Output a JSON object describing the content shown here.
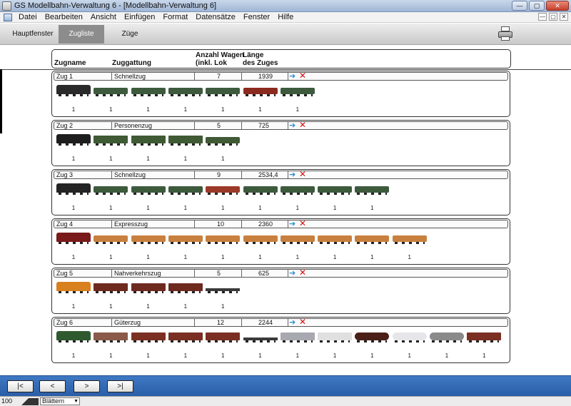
{
  "window": {
    "title": "GS Modellbahn-Verwaltung 6 - [Modellbahn-Verwaltung 6]",
    "controls": [
      "—",
      "▢",
      "✕"
    ]
  },
  "menu": [
    "Datei",
    "Bearbeiten",
    "Ansicht",
    "Einfügen",
    "Format",
    "Datensätze",
    "Fenster",
    "Hilfe"
  ],
  "tabs": [
    {
      "label": "Hauptfenster",
      "active": false
    },
    {
      "label": "Zugliste",
      "active": true
    },
    {
      "label": "Züge",
      "active": false
    }
  ],
  "columns": {
    "name": "Zugname",
    "type": "Zuggattung",
    "count_line1": "Anzahl Wagen",
    "count_line2": "(inkl. Lok",
    "length_line1": "Länge",
    "length_line2": "des Zuges"
  },
  "trains": [
    {
      "name": "Zug 1",
      "type": "Schnellzug",
      "count": "7",
      "length": "1939",
      "vehicles": [
        {
          "kind": "loco",
          "color": "#2a2a2a",
          "qty": "1"
        },
        {
          "kind": "car",
          "color": "#3d5a3d",
          "qty": "1"
        },
        {
          "kind": "car",
          "color": "#3d5a3d",
          "qty": "1"
        },
        {
          "kind": "car",
          "color": "#3d5a3d",
          "qty": "1"
        },
        {
          "kind": "car",
          "color": "#3d5a3d",
          "qty": "1"
        },
        {
          "kind": "car",
          "color": "#8b2a1e",
          "qty": "1"
        },
        {
          "kind": "car",
          "color": "#3d5a3d",
          "qty": "1"
        }
      ]
    },
    {
      "name": "Zug 2",
      "type": "Personenzug",
      "count": "5",
      "length": "725",
      "vehicles": [
        {
          "kind": "loco",
          "color": "#1e1e1e",
          "qty": "1"
        },
        {
          "kind": "wagon",
          "color": "#3f5a34",
          "qty": "1"
        },
        {
          "kind": "wagon",
          "color": "#3f5a34",
          "qty": "1"
        },
        {
          "kind": "wagon",
          "color": "#3f5a34",
          "qty": "1"
        },
        {
          "kind": "car",
          "color": "#3f5a34",
          "qty": "1"
        }
      ]
    },
    {
      "name": "Zug 3",
      "type": "Schnellzug",
      "count": "9",
      "length": "2534,4",
      "vehicles": [
        {
          "kind": "loco",
          "color": "#242424",
          "qty": "1"
        },
        {
          "kind": "car",
          "color": "#3d5a3d",
          "qty": "1"
        },
        {
          "kind": "car",
          "color": "#3d5a3d",
          "qty": "1"
        },
        {
          "kind": "car",
          "color": "#3d5a3d",
          "qty": "1"
        },
        {
          "kind": "car",
          "color": "#9c3a2a",
          "qty": "1"
        },
        {
          "kind": "car",
          "color": "#3d5a3d",
          "qty": "1"
        },
        {
          "kind": "car",
          "color": "#3d5a3d",
          "qty": "1"
        },
        {
          "kind": "car",
          "color": "#3d5a3d",
          "qty": "1"
        },
        {
          "kind": "car",
          "color": "#3d5a3d",
          "qty": "1"
        }
      ]
    },
    {
      "name": "Zug 4",
      "type": "Expresszug",
      "count": "10",
      "length": "2360",
      "vehicles": [
        {
          "kind": "loco",
          "color": "#7a1a1a",
          "qty": "1"
        },
        {
          "kind": "car",
          "color": "#c8803e",
          "qty": "1"
        },
        {
          "kind": "car",
          "color": "#c8803e",
          "qty": "1"
        },
        {
          "kind": "car",
          "color": "#c8803e",
          "qty": "1"
        },
        {
          "kind": "car",
          "color": "#c8803e",
          "qty": "1"
        },
        {
          "kind": "car",
          "color": "#c8803e",
          "qty": "1"
        },
        {
          "kind": "car",
          "color": "#c8803e",
          "qty": "1"
        },
        {
          "kind": "car",
          "color": "#c8803e",
          "qty": "1"
        },
        {
          "kind": "car",
          "color": "#c8803e",
          "qty": "1"
        },
        {
          "kind": "car",
          "color": "#c8803e",
          "qty": "1"
        }
      ]
    },
    {
      "name": "Zug 5",
      "type": "Nahverkehrszug",
      "count": "5",
      "length": "625",
      "vehicles": [
        {
          "kind": "loco",
          "color": "#d9801f",
          "qty": "1"
        },
        {
          "kind": "wagon",
          "color": "#6e2a1f",
          "qty": "1"
        },
        {
          "kind": "wagon",
          "color": "#6e2a1f",
          "qty": "1"
        },
        {
          "kind": "wagon",
          "color": "#6e2a1f",
          "qty": "1"
        },
        {
          "kind": "flat",
          "color": "#3a3a3a",
          "qty": "1"
        }
      ]
    },
    {
      "name": "Zug 6",
      "type": "Güterzug",
      "count": "12",
      "length": "2244",
      "vehicles": [
        {
          "kind": "loco",
          "color": "#2f5a2f",
          "qty": "1"
        },
        {
          "kind": "wagon",
          "color": "#8a5a4a",
          "qty": "1"
        },
        {
          "kind": "wagon",
          "color": "#7a2f22",
          "qty": "1"
        },
        {
          "kind": "wagon",
          "color": "#7a2f22",
          "qty": "1"
        },
        {
          "kind": "wagon",
          "color": "#7a2f22",
          "qty": "1"
        },
        {
          "kind": "flat",
          "color": "#3a3a3a",
          "qty": "1"
        },
        {
          "kind": "wagon",
          "color": "#a8a8b0",
          "qty": "1"
        },
        {
          "kind": "wagon",
          "color": "#e0e0e0",
          "qty": "1"
        },
        {
          "kind": "tank",
          "color": "#4a2018",
          "qty": "1"
        },
        {
          "kind": "tank",
          "color": "#e6e6ea",
          "qty": "1"
        },
        {
          "kind": "tank",
          "color": "#8a8a8a",
          "qty": "1"
        },
        {
          "kind": "wagon",
          "color": "#7a2f22",
          "qty": "1"
        }
      ]
    }
  ],
  "navigation": [
    "|<",
    "<",
    ">",
    ">|"
  ],
  "status": {
    "zoom": "100",
    "mode": "Blättern"
  },
  "colors": {
    "accent": "#2f66b0",
    "delete": "#d01010",
    "arrow": "#2a8ad4"
  }
}
